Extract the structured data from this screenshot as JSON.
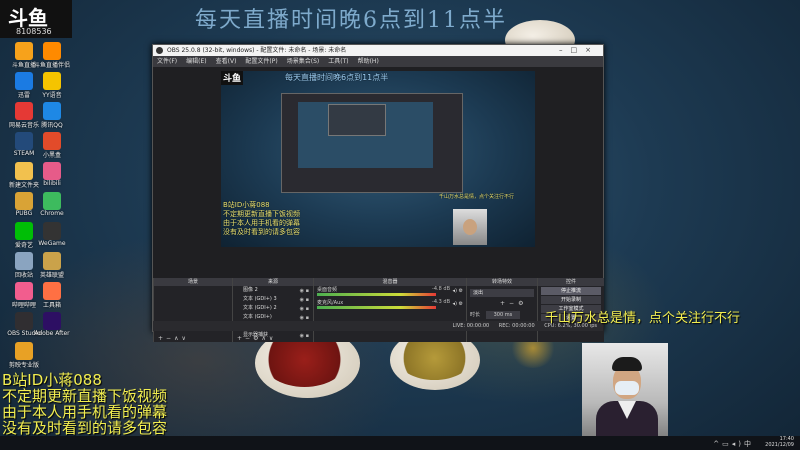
{
  "overlay": {
    "top_schedule": "每天直播时间晚6点到11点半",
    "left_lines": [
      "B站ID小蒋088",
      "不定期更新直播下饭视频",
      "由于本人用手机看的弹幕",
      "没有及时看到的请多包容"
    ],
    "right_line": "千山万水总是情，点个关注行不行"
  },
  "logo": {
    "brand": "斗鱼",
    "room_id": "8108536"
  },
  "desktop_icons": [
    {
      "label": "斗鱼直播",
      "color": "#f7a21b"
    },
    {
      "label": "斗鱼直播伴侣",
      "color": "#ff8a00"
    },
    {
      "label": "迅雷",
      "color": "#1b7be3"
    },
    {
      "label": "YY语音",
      "color": "#f5c400"
    },
    {
      "label": "网易云音乐",
      "color": "#e53935"
    },
    {
      "label": "腾讯QQ",
      "color": "#1e88e5"
    },
    {
      "label": "STEAM",
      "color": "#234a7a"
    },
    {
      "label": "小黑盒",
      "color": "#e24b2a"
    },
    {
      "label": "新建文件夹",
      "color": "#f2c14e"
    },
    {
      "label": "bilibili",
      "color": "#e65b89"
    },
    {
      "label": "PUBG",
      "color": "#d9a336"
    },
    {
      "label": "Chrome",
      "color": "#3dbb5e"
    },
    {
      "label": "爱奇艺",
      "color": "#00be06"
    },
    {
      "label": "WeGame",
      "color": "#333333"
    },
    {
      "label": "回收站",
      "color": "#8aa4c0"
    },
    {
      "label": "英雄联盟",
      "color": "#caa24a"
    },
    {
      "label": "哔哩哔哩",
      "color": "#f25d8e"
    },
    {
      "label": "工具箱",
      "color": "#ff7043"
    },
    {
      "label": "OBS Studio",
      "color": "#302e31"
    },
    {
      "label": "Adobe After",
      "color": "#2d0f63"
    },
    {
      "label": "剪映专业版",
      "color": "#e8a125"
    }
  ],
  "obs": {
    "title": "OBS 25.0.8 (32-bit, windows) - 配置文件: 未命名 - 场景: 未命名",
    "menu": [
      "文件(F)",
      "编辑(E)",
      "查看(V)",
      "配置文件(P)",
      "场景集合(S)",
      "工具(T)",
      "帮助(H)"
    ],
    "docks": {
      "scenes": "场景",
      "sources": "来源",
      "mixer": "混音器",
      "transitions": "转场特效",
      "controls": "控件"
    },
    "sources": [
      "图像 2",
      "文本 (GDI+) 3",
      "文本 (GDI+) 2",
      "文本 (GDI+)",
      "图像",
      "显示器捕获"
    ],
    "mixer": [
      {
        "name": "桌面音频",
        "db": "-4.8 dB"
      },
      {
        "name": "麦克风/Aux",
        "db": "-4.3 dB"
      }
    ],
    "transition": {
      "type": "淡出",
      "duration_label": "时长",
      "duration_value": "300 ms"
    },
    "controls": [
      "停止推流",
      "开始录制",
      "工作室模式",
      "设置",
      "退出"
    ],
    "status": {
      "live": "LIVE: 00:00:00",
      "rec": "REC: 00:00:00",
      "cpu": "CPU: 6.2%, 30.00 fps"
    }
  },
  "tray": {
    "time": "17:40",
    "date": "2021/12/09"
  }
}
